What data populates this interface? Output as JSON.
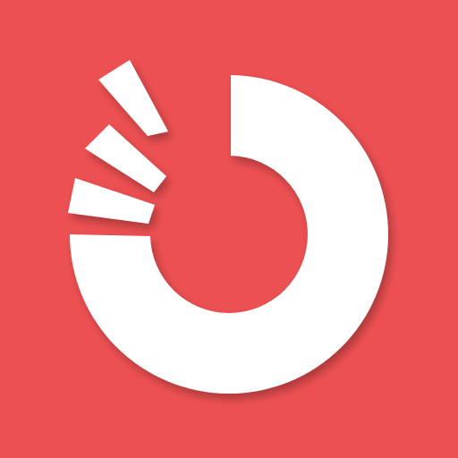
{
  "icon": {
    "name": "ring-loader-logo-icon",
    "colors": {
      "background": "#ED5052",
      "foreground": "#FFFFFF",
      "shadow": "#000000"
    }
  }
}
